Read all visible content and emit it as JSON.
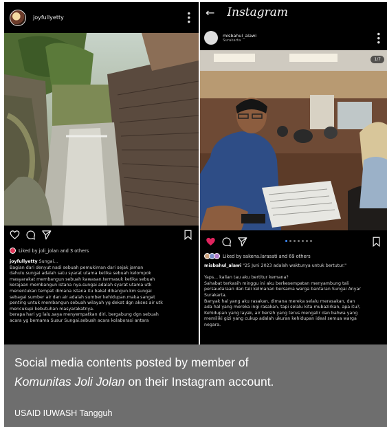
{
  "left_post": {
    "username": "joyfullyetty",
    "likes_text": "Liked by joli_jolan and 3 others",
    "caption_user": "joyfullyetty",
    "caption_first": "Sungai...",
    "caption_lines": [
      "Bagian dari denyut nadi sebuah pemukiman dari sejak jaman",
      "dahulu.sungai adalah satu syarat utama ketika sebuah kelompok",
      "masyarakat membangun sebuah kawasan.termasuk ketika sebuah",
      "kerajaan membangun istana nya.sungai adalah syarat utama utk",
      "menentukan tempat dimana istana itu bakal dibangun.km sungai",
      "sebagai sumber air dan air adalah sumber kehidupan.maka sangat",
      "penting untuk membangun sebuah wilayah yg dekat dgn akses air utk",
      "mencukupi kebutuhan masyarakatnya.",
      "berapa hari yg lalu.saya menyempatkan diri, bergabung dgn sebuah",
      "acara yg bernama Susur Sungai.sebuah acara kolaborasi antara"
    ]
  },
  "right_post": {
    "app_title": "Instagram",
    "username": "misbahul_alawi",
    "location": "Surakarta",
    "image_counter": "1/7",
    "likes_text": "Liked by sakena.larasati and 69 others",
    "caption_user": "misbahul_alawi",
    "caption_first": "\"25 Juni 2023 adalah waktunya untuk bertutur.\"",
    "caption_lines": [
      "",
      "Yaps... kalian tau aku bertitur kemana?",
      "Sahabat terkasih minggu ini aku berkesempatan menyambung tali",
      "persaudaraan dan tali kelmanan bersama warga bantaran Sungai Anyar",
      "Surakarta.",
      "Banyak hal yang aku rasakan, dimana mereka selalu merasakan, dan",
      "ada hal yang mereka ingi rasakan, tapi selalu kita mubazirkan, apa itu?,",
      "Kehidupan yang layak, air bersih yang terus mengalir dan bahwa yang",
      "memiliki gizi yang cukup adalah ukuran kehidupan ideal semua warga",
      "negara."
    ]
  },
  "banner": {
    "line1": "Social media contents posted by member of",
    "line2_italic": "Komunitas Joli Jolan",
    "line2_rest": " on their Instagram account.",
    "credit": "USAID IUWASH Tangguh"
  },
  "colors": {
    "banner_bg": "#6e6e6e",
    "like_heart": "#e0245e",
    "dot_active": "#3d8bfd"
  }
}
